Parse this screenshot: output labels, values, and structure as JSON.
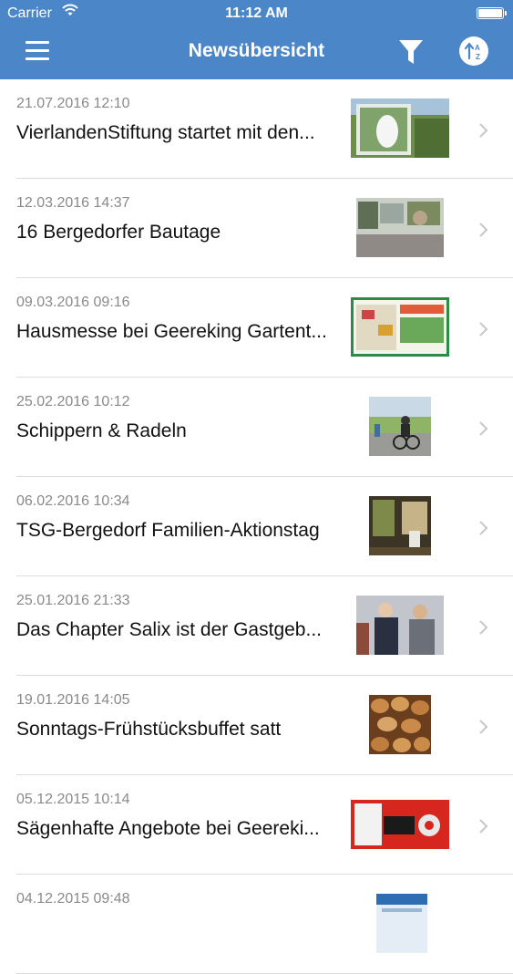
{
  "status_bar": {
    "carrier": "Carrier",
    "time": "11:12 AM"
  },
  "nav": {
    "title": "Newsübersicht",
    "icons": {
      "menu": "menu-icon",
      "filter": "filter-icon",
      "sort": "sort-az-icon"
    }
  },
  "items": [
    {
      "date": "21.07.2016 12:10",
      "title": "VierlandenStiftung startet mit den..."
    },
    {
      "date": "12.03.2016 14:37",
      "title": "16 Bergedorfer Bautage"
    },
    {
      "date": "09.03.2016 09:16",
      "title": "Hausmesse bei Geereking Gartent..."
    },
    {
      "date": "25.02.2016 10:12",
      "title": "Schippern & Radeln"
    },
    {
      "date": "06.02.2016 10:34",
      "title": "TSG-Bergedorf Familien-Aktionstag"
    },
    {
      "date": "25.01.2016 21:33",
      "title": "Das Chapter Salix ist der Gastgeb..."
    },
    {
      "date": "19.01.2016 14:05",
      "title": "Sonntags-Frühstücksbuffet satt"
    },
    {
      "date": "05.12.2015 10:14",
      "title": "Sägenhafte Angebote bei Geereki..."
    },
    {
      "date": "04.12.2015 09:48",
      "title": ""
    }
  ],
  "colors": {
    "header": "#4a86c8",
    "date_text": "#8a8a8a",
    "title_text": "#111111",
    "chevron": "#c7c7cc"
  }
}
